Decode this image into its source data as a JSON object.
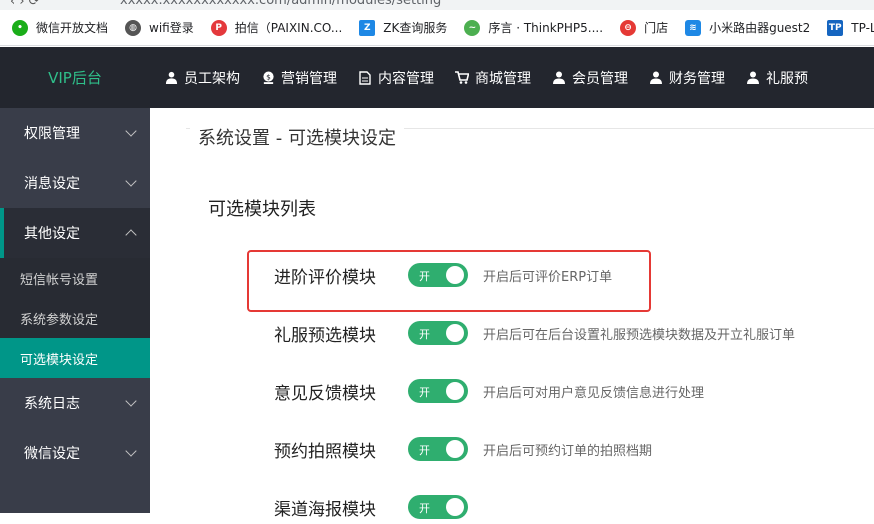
{
  "browser": {
    "url": "xxxxx.xxxxxxxxxxxx.com/admin/modules/setting"
  },
  "bookmarks": [
    {
      "icon": "wechat-icon",
      "label": "微信开放文档",
      "color": "#1aad19"
    },
    {
      "icon": "globe-icon",
      "label": "wifi登录",
      "color": "#555555"
    },
    {
      "icon": "paixin-icon",
      "label": "拍信（PAIXIN.CO...",
      "color": "#e4393c"
    },
    {
      "icon": "zk-icon",
      "label": "ZK查询服务",
      "color": "#1e88e5"
    },
    {
      "icon": "thinkphp-icon",
      "label": "序言 · ThinkPHP5....",
      "color": "#4caf50"
    },
    {
      "icon": "store-icon",
      "label": "门店",
      "color": "#e53935"
    },
    {
      "icon": "wifi-icon",
      "label": "小米路由器guest2",
      "color": "#1e88e5"
    },
    {
      "icon": "tplink-icon",
      "label": "TP-L",
      "color": "#1565c0"
    }
  ],
  "header": {
    "logo": "VIP后台",
    "nav": [
      {
        "icon": "user-icon",
        "label": "员工架构"
      },
      {
        "icon": "coin-icon",
        "label": "营销管理"
      },
      {
        "icon": "document-icon",
        "label": "内容管理"
      },
      {
        "icon": "cart-icon",
        "label": "商城管理"
      },
      {
        "icon": "member-icon",
        "label": "会员管理"
      },
      {
        "icon": "finance-icon",
        "label": "财务管理"
      },
      {
        "icon": "dress-icon",
        "label": "礼服预"
      }
    ]
  },
  "sidebar": {
    "groups": [
      {
        "label": "权限管理",
        "expanded": false
      },
      {
        "label": "消息设定",
        "expanded": false
      },
      {
        "label": "其他设定",
        "expanded": true
      }
    ],
    "sub_items": [
      {
        "label": "短信帐号设置",
        "selected": false
      },
      {
        "label": "系统参数设定",
        "selected": false
      },
      {
        "label": "可选模块设定",
        "selected": true
      }
    ],
    "groups_after": [
      {
        "label": "系统日志",
        "expanded": false
      },
      {
        "label": "微信设定",
        "expanded": false
      }
    ]
  },
  "main": {
    "legend": "系统设置 - 可选模块设定",
    "section_title": "可选模块列表",
    "switch_on_text": "开",
    "modules": [
      {
        "name": "进阶评价模块",
        "on": true,
        "desc": "开启后可评价ERP订单"
      },
      {
        "name": "礼服预选模块",
        "on": true,
        "desc": "开启后可在后台设置礼服预选模块数据及开立礼服订单"
      },
      {
        "name": "意见反馈模块",
        "on": true,
        "desc": "开启后可对用户意见反馈信息进行处理"
      },
      {
        "name": "预约拍照模块",
        "on": true,
        "desc": "开启后可预约订单的拍照档期"
      },
      {
        "name": "渠道海报模块",
        "on": true,
        "desc": ""
      }
    ]
  },
  "colors": {
    "header_bg": "#23262e",
    "sidebar_bg": "#393d49",
    "accent": "#009688",
    "switch_on": "#2fae6f",
    "highlight": "#e53935"
  }
}
